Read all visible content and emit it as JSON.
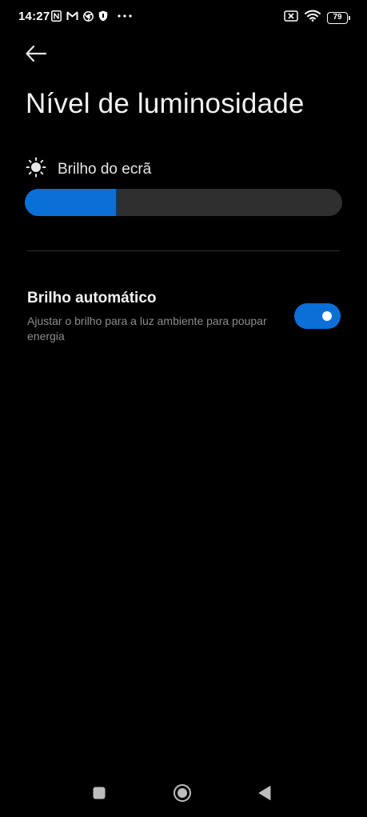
{
  "status_bar": {
    "time": "14:27",
    "left_icons": [
      "nfc-icon",
      "gmail-icon",
      "chrome-icon",
      "shield-icon",
      "more-dots-icon"
    ],
    "right_icons": [
      "battery-saver-icon",
      "wifi-icon"
    ],
    "battery_level": "79"
  },
  "header": {
    "back_icon": "arrow-left-icon",
    "title": "Nível de luminosidade"
  },
  "brightness": {
    "icon": "sun-icon",
    "label": "Brilho do ecrã",
    "level_fraction": 0.29
  },
  "auto_brightness": {
    "title": "Brilho automático",
    "description": "Ajustar o brilho para a luz ambiente para poupar energia",
    "enabled": true
  },
  "nav_bar": {
    "icons": [
      "recents-square-icon",
      "home-circle-icon",
      "back-triangle-icon"
    ]
  },
  "colors": {
    "accent": "#0a70d8",
    "background": "#000000",
    "track": "#2f2f2f"
  }
}
